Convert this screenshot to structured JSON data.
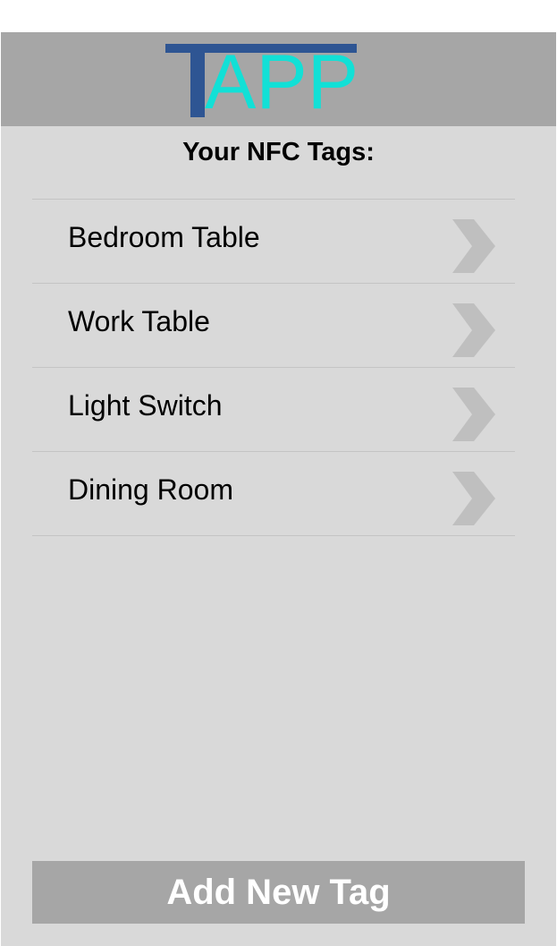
{
  "app": {
    "logo_text": "APP",
    "logo_initial": "T"
  },
  "header": {
    "title": "Your NFC Tags:"
  },
  "tags": [
    {
      "label": "Bedroom Table",
      "icon": "chevron-right-icon"
    },
    {
      "label": "Work Table",
      "icon": "chevron-right-icon"
    },
    {
      "label": "Light Switch",
      "icon": "chevron-right-icon"
    },
    {
      "label": "Dining Room",
      "icon": "chevron-right-icon"
    }
  ],
  "actions": {
    "add_label": "Add New Tag"
  },
  "colors": {
    "header_bg": "#a6a6a6",
    "screen_bg": "#d9d9d9",
    "logo_t": "#2e5593",
    "logo_text": "#12e0d6",
    "chevron": "#bfbfbf"
  }
}
